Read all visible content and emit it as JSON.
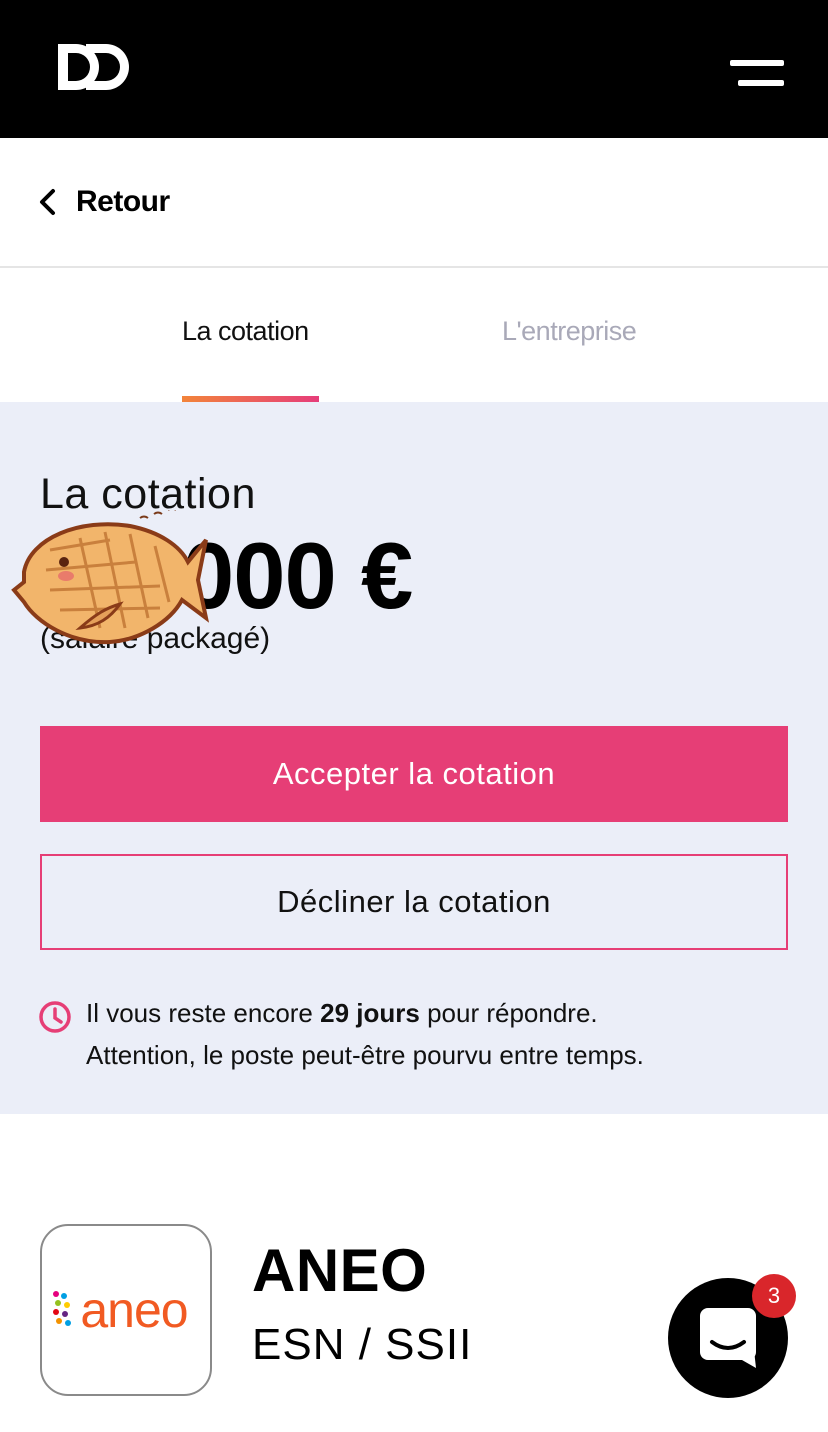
{
  "header": {
    "menu_icon": "hamburger-menu-icon",
    "logo_icon": "dd-logo-icon"
  },
  "nav": {
    "back_label": "Retour"
  },
  "tabs": [
    {
      "label": "La cotation",
      "active": true
    },
    {
      "label": "L'entreprise",
      "active": false
    }
  ],
  "offer": {
    "title": "La cotation",
    "price": "000 €",
    "price_note": "(salaire packagé)",
    "accept_label": "Accepter la cotation",
    "decline_label": "Décliner la cotation",
    "notice_before": "Il vous reste encore ",
    "notice_days": "29 jours",
    "notice_after": " pour répondre.",
    "notice_line2": "Attention, le poste peut-être pourvu entre temps."
  },
  "company": {
    "logo_text": "aneo",
    "name": "ANEO",
    "sector": "ESN / SSII"
  },
  "chat": {
    "badge_count": "3"
  },
  "colors": {
    "accent": "#e63e76",
    "panel_bg": "#ebeef8",
    "header_bg": "#000000",
    "badge": "#d9262b"
  }
}
